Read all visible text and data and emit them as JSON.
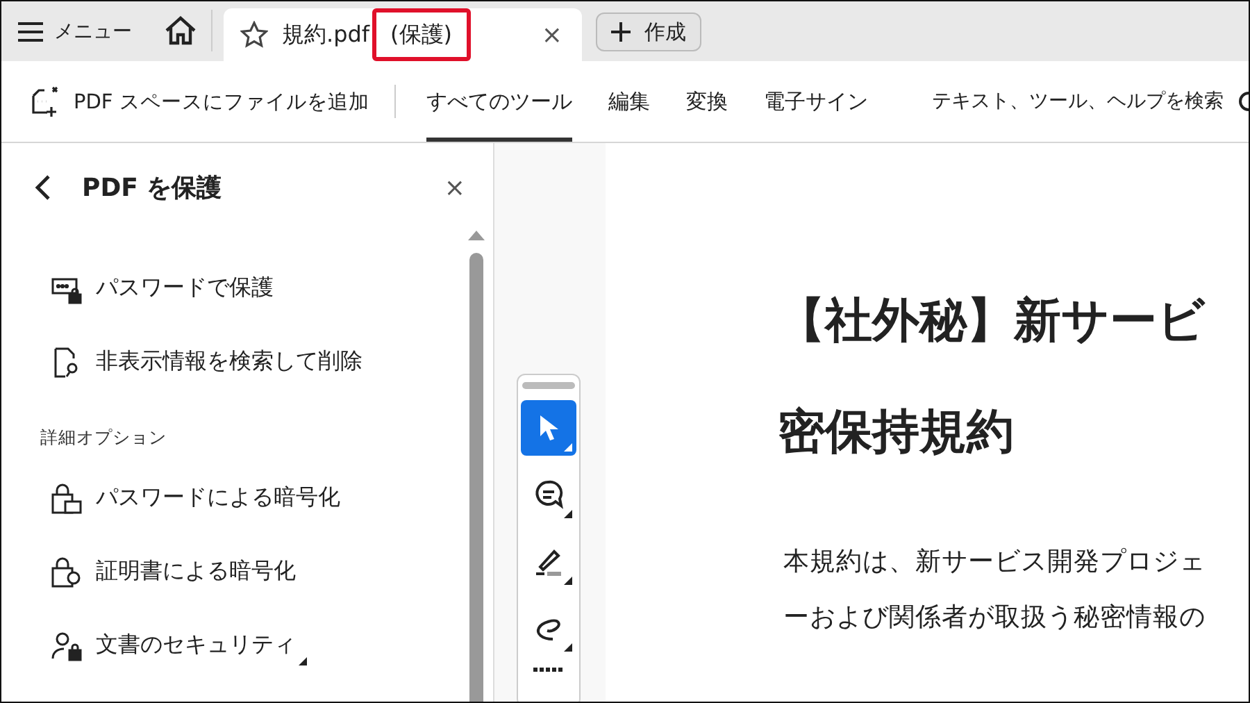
{
  "tab_bar": {
    "menu_label": "メニュー",
    "tabs": [
      {
        "title": "規約.pdf",
        "suffix": "(保護)",
        "selected": true,
        "highlighted": true,
        "close": "×"
      }
    ],
    "create_label": "作成"
  },
  "toolbar": {
    "add_label": "PDF スペースにファイルを追加",
    "tabs": [
      {
        "label": "すべてのツール",
        "selected": true
      },
      {
        "label": "編集",
        "selected": false
      },
      {
        "label": "変換",
        "selected": false
      },
      {
        "label": "電子サイン",
        "selected": false
      }
    ],
    "search_placeholder": "テキスト、ツール、ヘルプを検索"
  },
  "panel": {
    "title": "PDF を保護",
    "close": "×",
    "items": [
      {
        "kind": "item",
        "label": "パスワードで保護",
        "submenu": false
      },
      {
        "kind": "item",
        "label": "非表示情報を検索して削除",
        "submenu": false
      },
      {
        "kind": "heading",
        "label": "詳細オプション"
      },
      {
        "kind": "item",
        "label": "パスワードによる暗号化",
        "submenu": false
      },
      {
        "kind": "item",
        "label": "証明書による暗号化",
        "submenu": false
      },
      {
        "kind": "item",
        "label": "文書のセキュリティ",
        "submenu": true
      }
    ]
  },
  "tools": [
    {
      "selected": true
    },
    {
      "selected": false
    },
    {
      "selected": false
    },
    {
      "selected": false
    }
  ],
  "document": {
    "title_lines": [
      "【社外秘】新サービ",
      "密保持規約"
    ],
    "body_lines": [
      "本規約は、新サービス開発プロジェ",
      "ーおよび関係者が取扱う秘密情報の"
    ]
  }
}
